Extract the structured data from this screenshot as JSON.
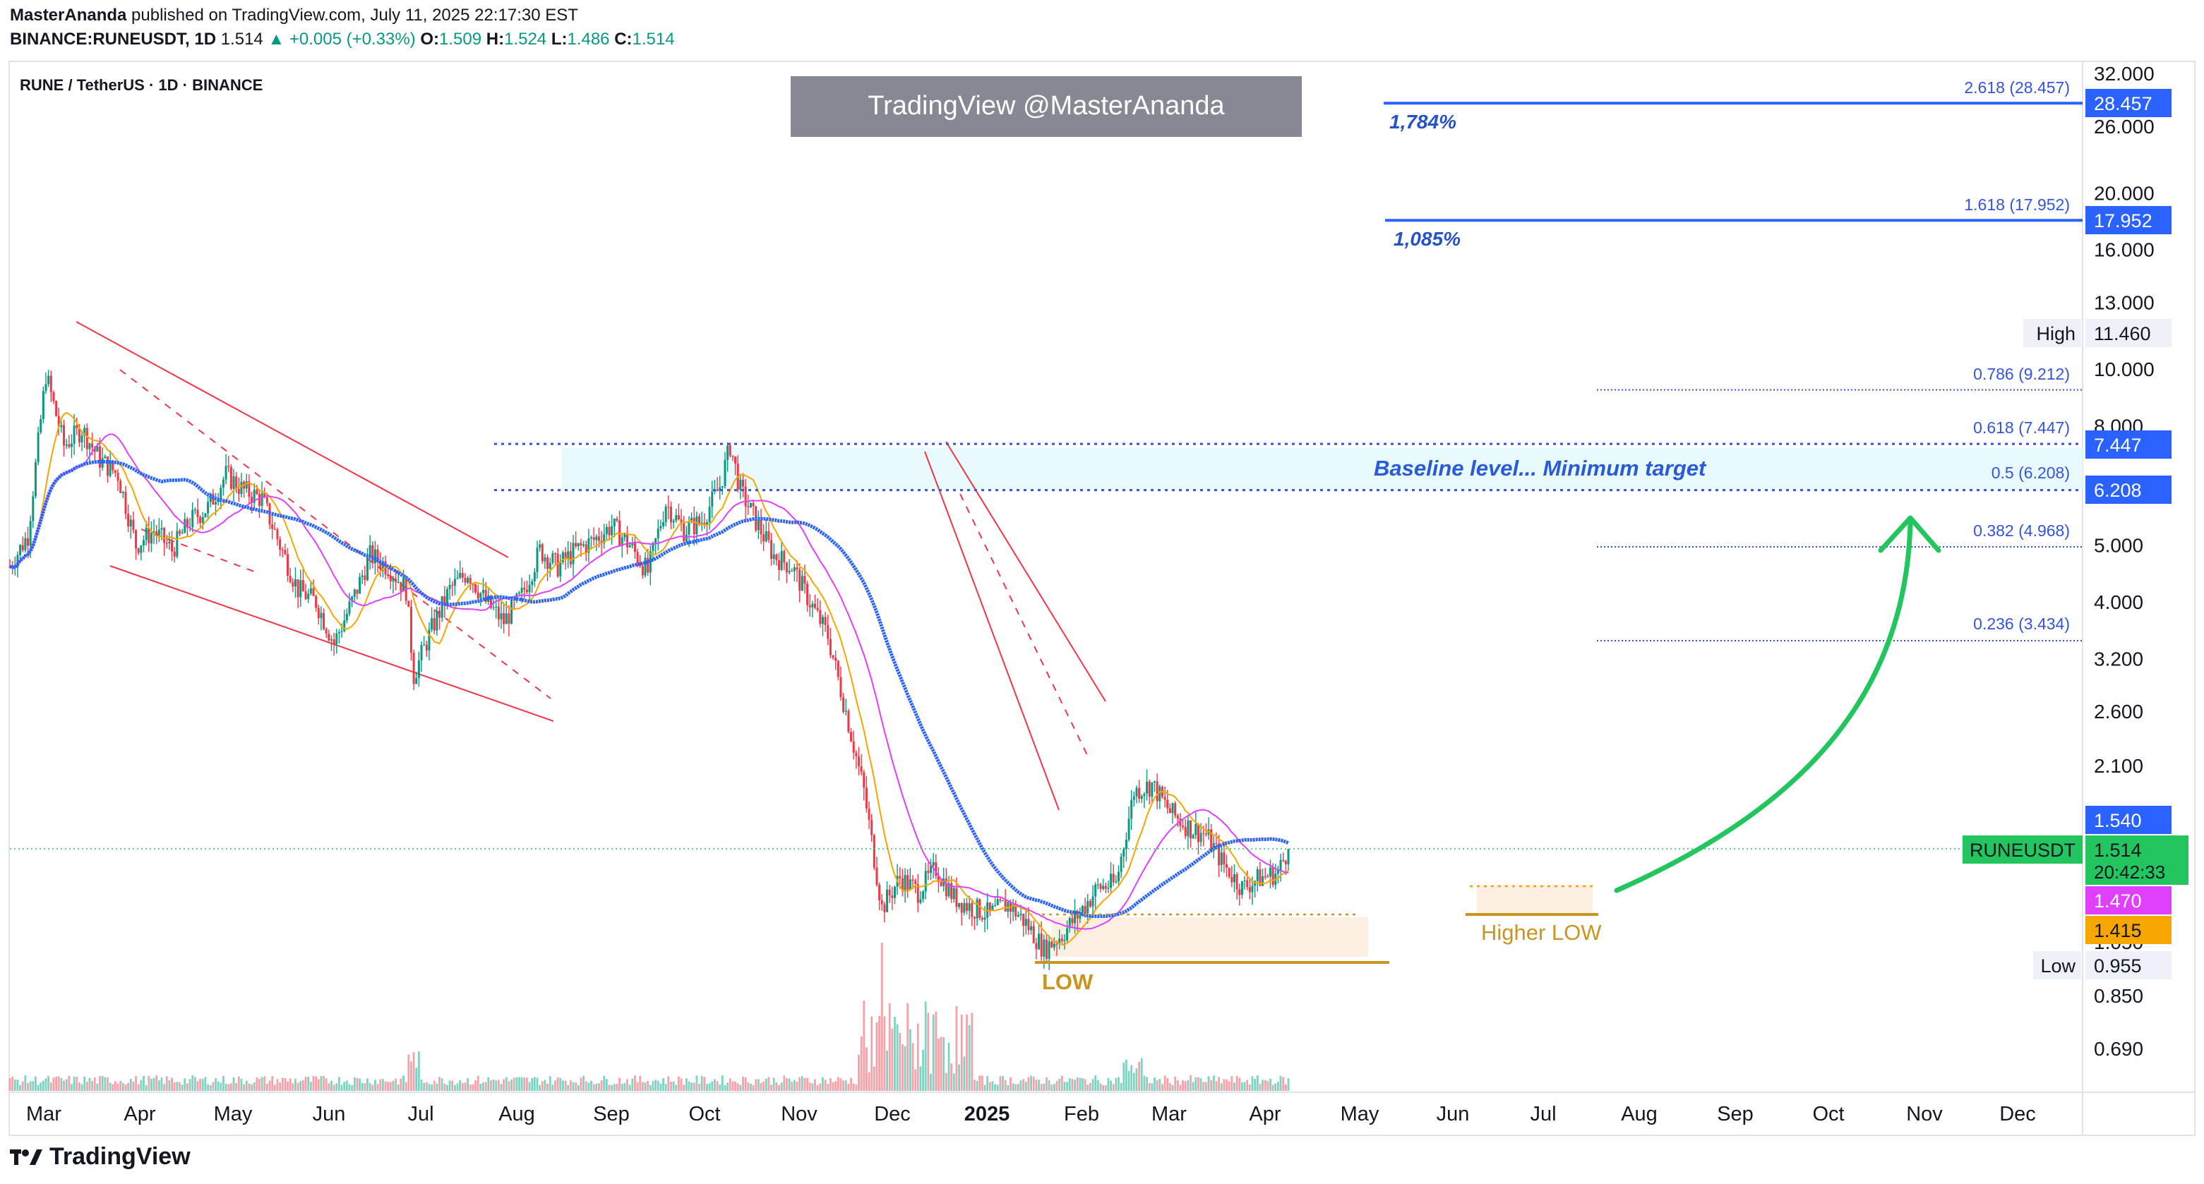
{
  "header": {
    "author": "MasterAnanda",
    "published_text": "published on TradingView.com, July 11, 2025 22:17:30 EST",
    "symbol": "BINANCE:RUNEUSDT, 1D",
    "last": "1.514",
    "change": "+0.005 (+0.33%)",
    "o_label": "O:",
    "o_value": "1.509",
    "h_label": "H:",
    "h_value": "1.524",
    "l_label": "L:",
    "l_value": "1.486",
    "c_label": "C:",
    "c_value": "1.514"
  },
  "watermark": "TradingView @MasterAnanda",
  "footer": {
    "brand": "TradingView"
  },
  "colors": {
    "up": "#089981",
    "down": "#f23645",
    "blue_ma": "#2962ff",
    "orange_ma": "#f7a600",
    "pink_ma": "#e040fb",
    "arrow": "#22c55e",
    "annot_gold": "#c8961e",
    "fib": "#3455db"
  },
  "chart_data": {
    "type": "candlestick",
    "title": "RUNE / TetherUS · 1D · BINANCE",
    "y_scale": "log",
    "ylim": [
      0.62,
      34
    ],
    "x_ticks": [
      "Mar",
      "Apr",
      "May",
      "Jun",
      "Jul",
      "Aug",
      "Sep",
      "Oct",
      "Nov",
      "Dec",
      "2025",
      "Feb",
      "Mar",
      "Apr",
      "May",
      "Jun",
      "Jul",
      "Aug",
      "Sep",
      "Oct",
      "Nov",
      "Dec"
    ],
    "y_ticks": [
      "32.000",
      "26.000",
      "20.000",
      "16.000",
      "13.000",
      "10.000",
      "8.000",
      "5.000",
      "4.000",
      "3.200",
      "2.600",
      "2.100",
      "1.050",
      "0.850",
      "0.690"
    ],
    "price_path": [
      [
        "2024-03-01",
        4.6
      ],
      [
        "2024-03-08",
        5.2
      ],
      [
        "2024-03-15",
        9.8
      ],
      [
        "2024-03-22",
        7.4
      ],
      [
        "2024-03-29",
        7.9
      ],
      [
        "2024-04-05",
        7.0
      ],
      [
        "2024-04-12",
        6.6
      ],
      [
        "2024-04-19",
        5.0
      ],
      [
        "2024-04-26",
        5.3
      ],
      [
        "2024-05-03",
        4.9
      ],
      [
        "2024-05-10",
        5.5
      ],
      [
        "2024-05-17",
        5.8
      ],
      [
        "2024-05-24",
        6.6
      ],
      [
        "2024-05-31",
        6.2
      ],
      [
        "2024-06-07",
        6.0
      ],
      [
        "2024-06-14",
        5.0
      ],
      [
        "2024-06-21",
        4.2
      ],
      [
        "2024-06-28",
        4.0
      ],
      [
        "2024-07-05",
        3.4
      ],
      [
        "2024-07-12",
        4.0
      ],
      [
        "2024-07-19",
        4.8
      ],
      [
        "2024-07-26",
        4.6
      ],
      [
        "2024-08-02",
        4.2
      ],
      [
        "2024-08-05",
        3.0
      ],
      [
        "2024-08-12",
        3.6
      ],
      [
        "2024-08-19",
        4.2
      ],
      [
        "2024-08-26",
        4.5
      ],
      [
        "2024-09-02",
        4.0
      ],
      [
        "2024-09-09",
        3.7
      ],
      [
        "2024-09-16",
        4.1
      ],
      [
        "2024-09-23",
        4.9
      ],
      [
        "2024-09-30",
        4.6
      ],
      [
        "2024-10-07",
        4.9
      ],
      [
        "2024-10-14",
        5.1
      ],
      [
        "2024-10-21",
        5.4
      ],
      [
        "2024-10-28",
        5.0
      ],
      [
        "2024-11-04",
        4.5
      ],
      [
        "2024-11-11",
        5.9
      ],
      [
        "2024-11-18",
        5.3
      ],
      [
        "2024-11-25",
        5.5
      ],
      [
        "2024-12-02",
        6.3
      ],
      [
        "2024-12-06",
        7.4
      ],
      [
        "2024-12-10",
        6.2
      ],
      [
        "2024-12-16",
        5.5
      ],
      [
        "2024-12-23",
        4.8
      ],
      [
        "2024-12-30",
        4.6
      ],
      [
        "2025-01-06",
        4.0
      ],
      [
        "2025-01-13",
        3.5
      ],
      [
        "2025-01-20",
        2.6
      ],
      [
        "2025-01-27",
        1.9
      ],
      [
        "2025-02-03",
        1.2
      ],
      [
        "2025-02-10",
        1.35
      ],
      [
        "2025-02-17",
        1.28
      ],
      [
        "2025-02-24",
        1.4
      ],
      [
        "2025-03-03",
        1.25
      ],
      [
        "2025-03-10",
        1.2
      ],
      [
        "2025-03-17",
        1.17
      ],
      [
        "2025-03-24",
        1.22
      ],
      [
        "2025-03-31",
        1.13
      ],
      [
        "2025-04-07",
        1.02
      ],
      [
        "2025-04-14",
        1.08
      ],
      [
        "2025-04-21",
        1.18
      ],
      [
        "2025-04-28",
        1.3
      ],
      [
        "2025-05-05",
        1.32
      ],
      [
        "2025-05-12",
        1.9
      ],
      [
        "2025-05-19",
        1.95
      ],
      [
        "2025-05-26",
        1.75
      ],
      [
        "2025-06-02",
        1.65
      ],
      [
        "2025-06-09",
        1.6
      ],
      [
        "2025-06-16",
        1.42
      ],
      [
        "2025-06-23",
        1.3
      ],
      [
        "2025-06-30",
        1.35
      ],
      [
        "2025-07-07",
        1.38
      ],
      [
        "2025-07-11",
        1.514
      ]
    ],
    "levels": [
      {
        "label": "2.618 (28.457)",
        "value": 28.457,
        "axis_label": "28.457"
      },
      {
        "label": "1.618 (17.952)",
        "value": 17.952,
        "axis_label": "17.952"
      },
      {
        "label": "0.786 (9.212)",
        "value": 9.212
      },
      {
        "label": "0.618 (7.447)",
        "value": 7.447,
        "axis_label": "7.447"
      },
      {
        "label": "0.5 (6.208)",
        "value": 6.208,
        "axis_label": "6.208"
      },
      {
        "label": "0.382 (4.968)",
        "value": 4.968
      },
      {
        "label": "0.236 (3.434)",
        "value": 3.434
      }
    ],
    "pct_labels": {
      "p1784": "1,784%",
      "p1085": "1,085%"
    },
    "high": {
      "label": "High",
      "value": "11.460"
    },
    "low": {
      "label": "Low",
      "value": "0.955"
    },
    "ma_tags": {
      "blue": "1.540",
      "pink": "1.470",
      "orange": "1.415"
    },
    "current": {
      "symbol": "RUNEUSDT",
      "price": "1.514",
      "countdown": "20:42:33"
    },
    "annotations": {
      "baseline": "Baseline level... Minimum target",
      "low": "LOW",
      "higher_low": "Higher LOW"
    }
  }
}
